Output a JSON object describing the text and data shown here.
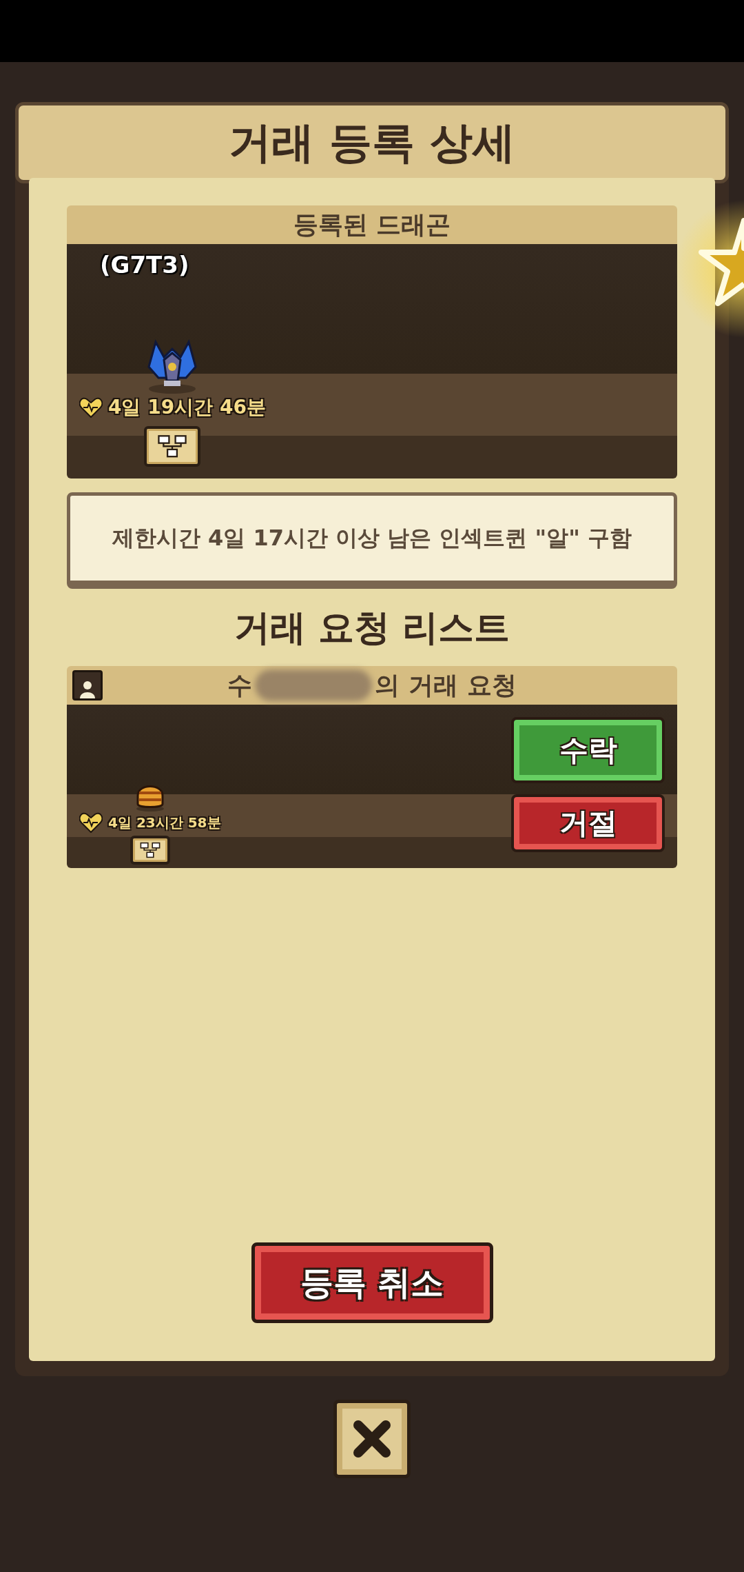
{
  "title": "거래 등록 상세",
  "registered": {
    "header": "등록된 드래곤",
    "item": {
      "kind": "dragon",
      "code": "(G7T3)",
      "lifetime": "4일 19시간 46분"
    }
  },
  "condition": "제한시간 4일 17시간 이상 남은 인섹트퀸 \"알\" 구함",
  "request_list": {
    "heading": "거래 요청 리스트",
    "requests": [
      {
        "name_start": "수",
        "name_end": "의 거래 요청",
        "item": {
          "kind": "egg",
          "lifetime": "4일 23시간 58분"
        },
        "buttons": [
          {
            "kind": "accept",
            "label": "수락"
          },
          {
            "kind": "reject",
            "label": "거절"
          }
        ]
      }
    ]
  },
  "cancel_button": "등록 취소"
}
